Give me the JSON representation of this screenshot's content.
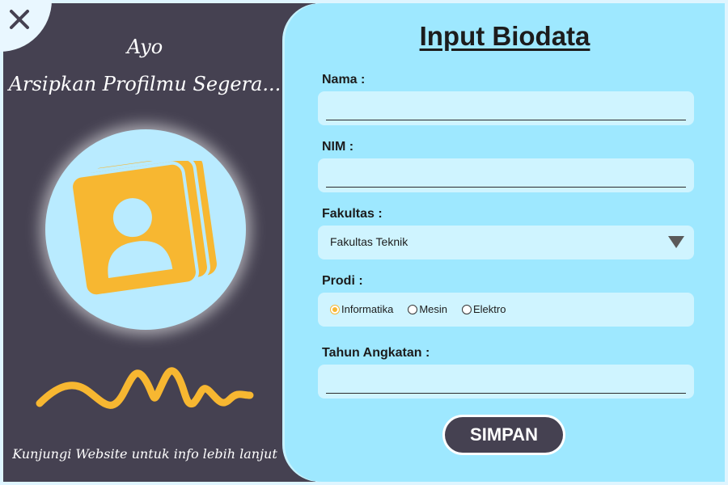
{
  "left": {
    "title_line1": "Ayo",
    "title_line2": "Arsipkan Profilmu Segera...",
    "footer": "Kunjungi Website untuk info lebih lanjut"
  },
  "form": {
    "title": "Input Biodata",
    "nama_label": "Nama :",
    "nama_value": "",
    "nim_label": "NIM :",
    "nim_value": "",
    "fakultas_label": "Fakultas :",
    "fakultas_value": "Fakultas Teknik",
    "prodi_label": "Prodi :",
    "prodi_options": [
      "Informatika",
      "Mesin",
      "Elektro"
    ],
    "prodi_selected": "Informatika",
    "tahun_label": "Tahun Angkatan :",
    "tahun_value": "",
    "save_label": "SIMPAN"
  },
  "colors": {
    "left_bg": "#454151",
    "right_bg": "#9ee8ff",
    "accent": "#f7b731"
  },
  "icons": {
    "close": "close-icon",
    "profile": "profile-cards-icon",
    "wave": "squiggle-decoration",
    "dropdown": "dropdown-triangle-icon"
  }
}
